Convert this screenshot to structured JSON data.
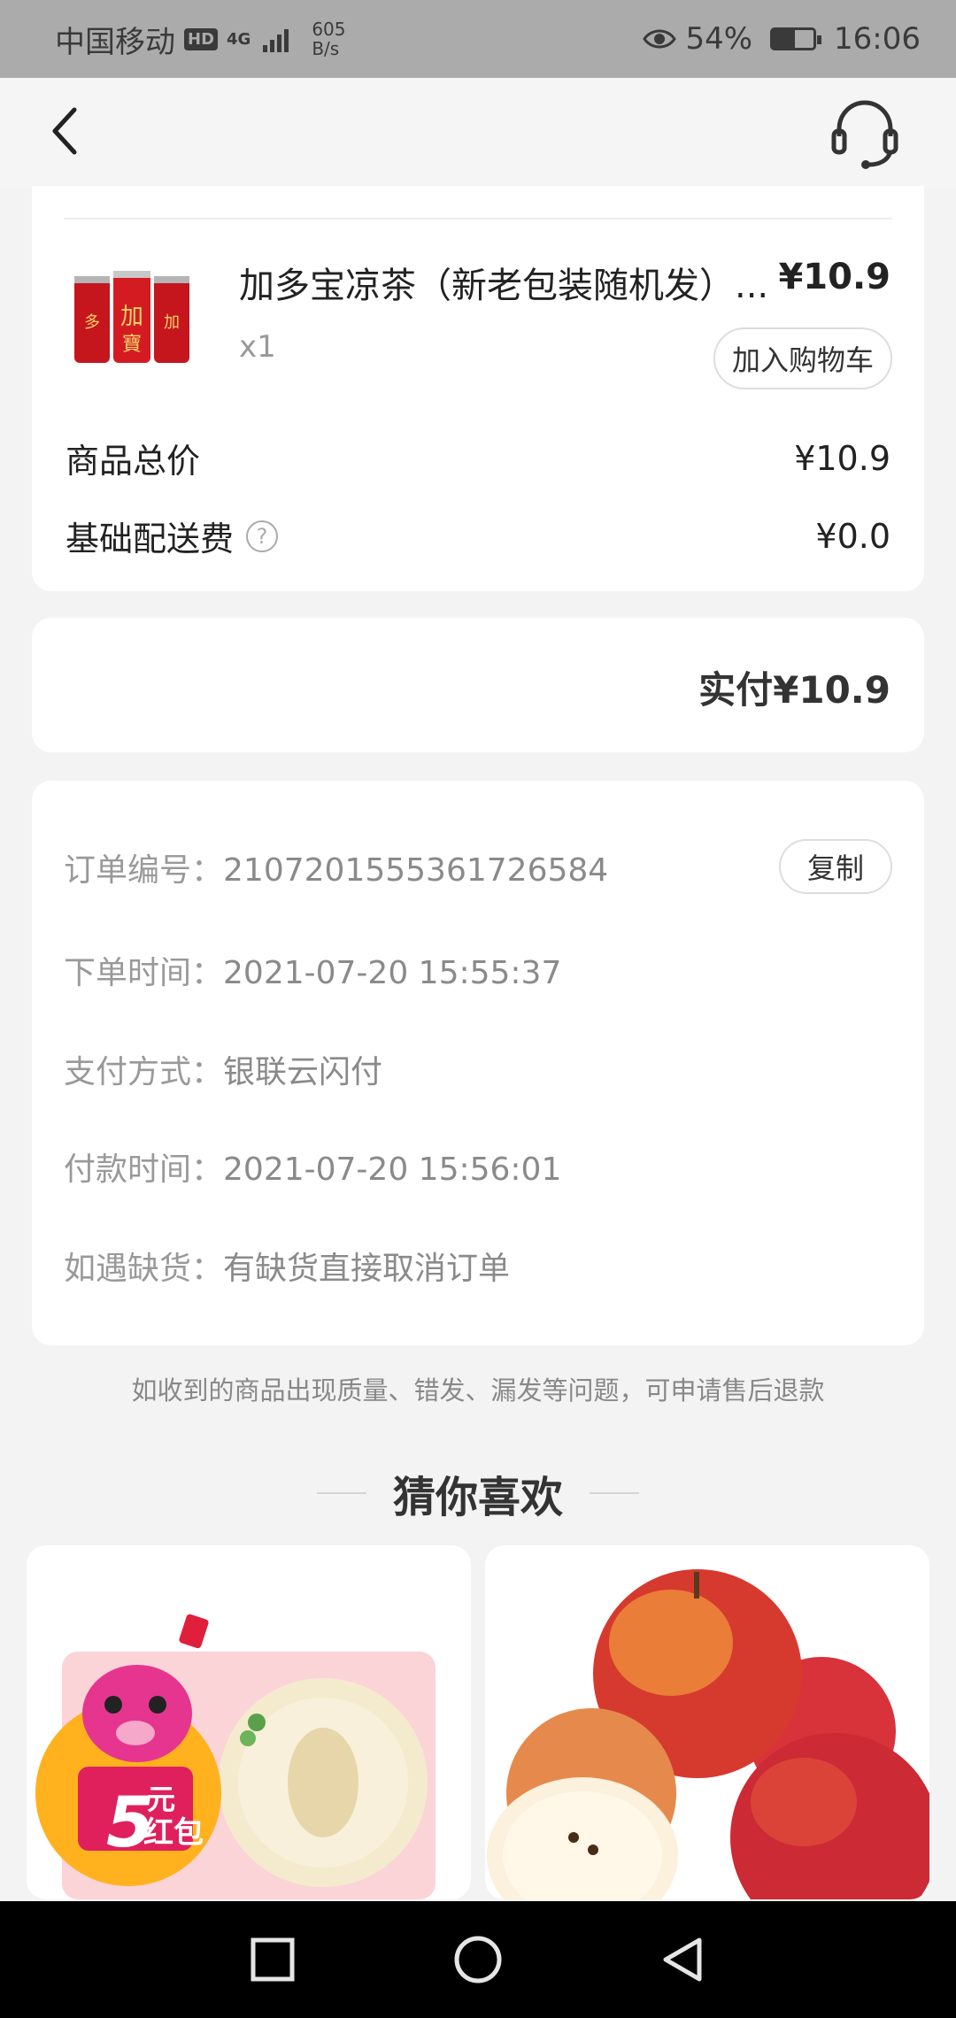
{
  "status_bar": {
    "carrier": "中国移动",
    "hd": "HD",
    "network": "4G",
    "speed_value": "605",
    "speed_unit": "B/s",
    "battery": "54%",
    "battery_level": 0.54,
    "time": "16:06"
  },
  "header": {
    "back_icon": "chevron-left-icon",
    "service_icon": "headset-icon"
  },
  "product": {
    "name": "加多宝凉茶（新老包装随机发）...",
    "price": "¥10.9",
    "quantity": "x1",
    "add_to_cart": "加入购物车"
  },
  "summary": {
    "goods_total_label": "商品总价",
    "goods_total_value": "¥10.9",
    "delivery_fee_label": "基础配送费",
    "delivery_fee_value": "¥0.0",
    "help_icon": "question-circle-icon"
  },
  "payment": {
    "paid_label": "实付",
    "paid_value": "¥10.9"
  },
  "order_info": {
    "order_no_label": "订单编号：",
    "order_no": "2107201555361726584",
    "copy": "复制",
    "order_time_label": "下单时间：",
    "order_time": "2021-07-20 15:55:37",
    "pay_method_label": "支付方式：",
    "pay_method": "银联云闪付",
    "pay_time_label": "付款时间：",
    "pay_time": "2021-07-20 15:56:01",
    "out_of_stock_label": "如遇缺货：",
    "out_of_stock": "有缺货直接取消订单"
  },
  "notice": "如收到的商品出现质量、错发、漏发等问题，可申请售后退款",
  "recommend": {
    "title": "猜你喜欢",
    "items": [
      {
        "name": "melon-promo",
        "badge_amount": "5",
        "badge_unit": "元",
        "badge_text": "红包"
      },
      {
        "name": "apples"
      }
    ]
  },
  "nav": {
    "recent": "square-icon",
    "home": "circle-icon",
    "back": "triangle-back-icon"
  }
}
